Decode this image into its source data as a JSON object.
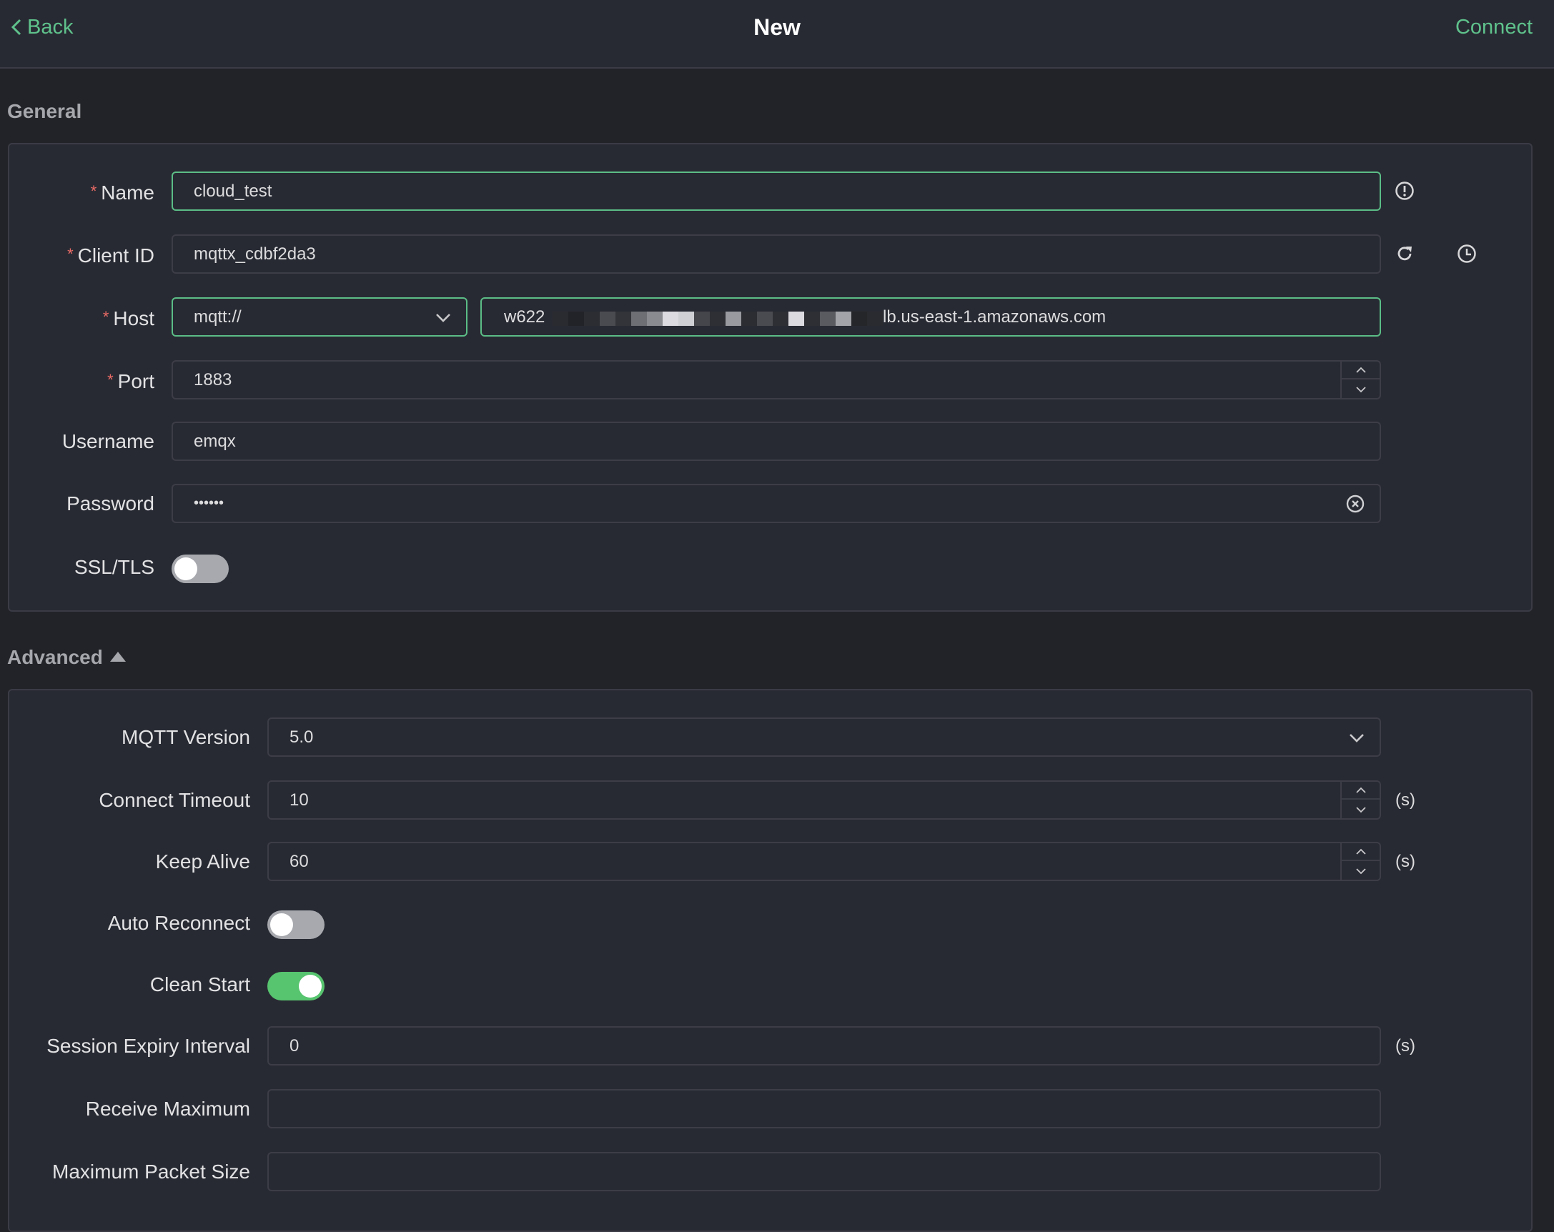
{
  "header": {
    "back_label": "Back",
    "title": "New",
    "connect_label": "Connect"
  },
  "colors": {
    "accent": "#5fc28c",
    "toggle_on": "#57c46f",
    "required": "#ea6b66"
  },
  "general": {
    "section_title": "General",
    "name": {
      "label": "Name",
      "required": "*",
      "value": "cloud_test"
    },
    "client_id": {
      "label": "Client ID",
      "required": "*",
      "value": "mqttx_cdbf2da3"
    },
    "host": {
      "label": "Host",
      "required": "*",
      "protocol": "mqtt://",
      "value_prefix": "w622",
      "value_suffix": "lb.us-east-1.amazonaws.com",
      "redacted": true
    },
    "port": {
      "label": "Port",
      "required": "*",
      "value": "1883"
    },
    "username": {
      "label": "Username",
      "value": "emqx"
    },
    "password": {
      "label": "Password",
      "value": "••••••"
    },
    "ssl_tls": {
      "label": "SSL/TLS",
      "enabled": false
    }
  },
  "advanced": {
    "section_title": "Advanced",
    "mqtt_version": {
      "label": "MQTT Version",
      "value": "5.0"
    },
    "connect_timeout": {
      "label": "Connect Timeout",
      "value": "10",
      "unit": "(s)"
    },
    "keep_alive": {
      "label": "Keep Alive",
      "value": "60",
      "unit": "(s)"
    },
    "auto_reconnect": {
      "label": "Auto Reconnect",
      "enabled": false
    },
    "clean_start": {
      "label": "Clean Start",
      "enabled": true
    },
    "session_expiry": {
      "label": "Session Expiry Interval",
      "value": "0",
      "unit": "(s)"
    },
    "receive_maximum": {
      "label": "Receive Maximum",
      "value": ""
    },
    "max_packet_size": {
      "label": "Maximum Packet Size",
      "value": ""
    }
  }
}
